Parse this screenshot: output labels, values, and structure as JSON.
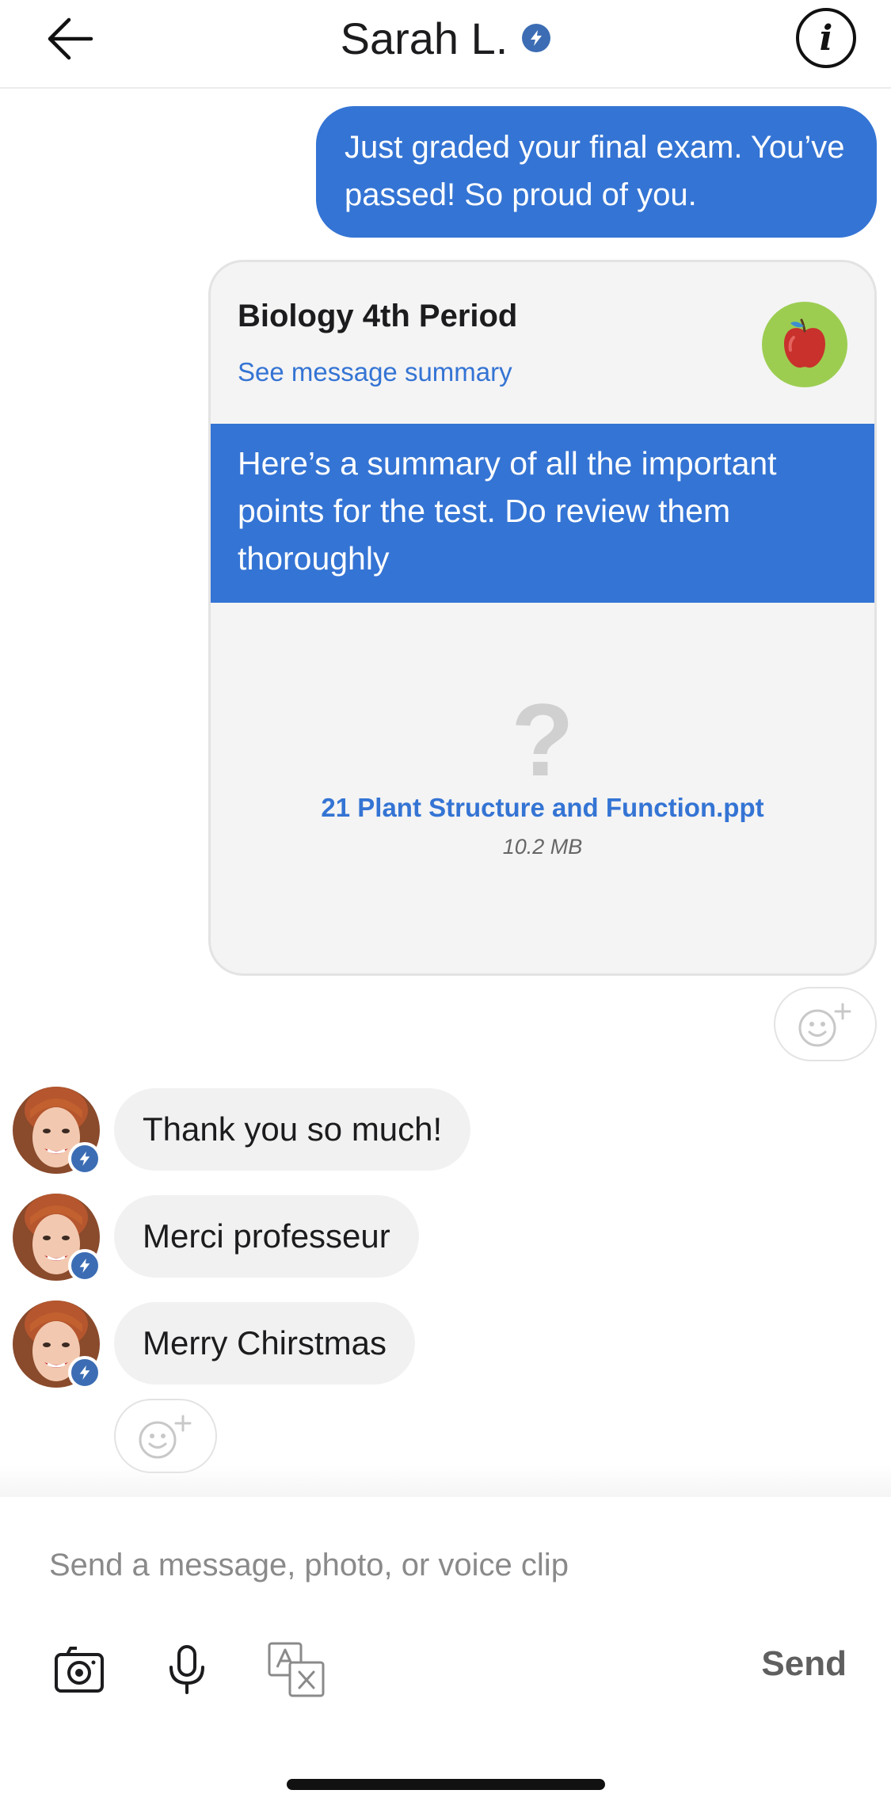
{
  "header": {
    "back_icon": "arrow-left-icon",
    "title": "Sarah L.",
    "verified_icon": "bolt-badge-icon",
    "info_icon": "info-circle-icon",
    "info_glyph": "i"
  },
  "messages": {
    "outgoing_text": "Just graded your final exam. You’ve passed! So proud of you.",
    "card": {
      "title": "Biology 4th Period",
      "link": "See message summary",
      "badge_icon": "apple-icon",
      "badge_color": "#9ccd51",
      "message": "Here’s a summary of all the important points for the test. Do review them thoroughly",
      "file_icon": "?",
      "file_name": "21 Plant Structure and Function.ppt",
      "file_size": "10.2 MB"
    },
    "incoming": [
      {
        "text": "Thank you so much!"
      },
      {
        "text": "Merci professeur"
      },
      {
        "text": "Merry Chirstmas"
      }
    ]
  },
  "composer": {
    "placeholder": "Send a message, photo, or voice clip",
    "send_label": "Send",
    "tools": [
      "camera-icon",
      "microphone-icon",
      "translate-icon"
    ]
  },
  "colors": {
    "accent": "#3474d4",
    "verified_badge": "#3c6db4",
    "incoming_bubble": "#f1f1f1"
  }
}
